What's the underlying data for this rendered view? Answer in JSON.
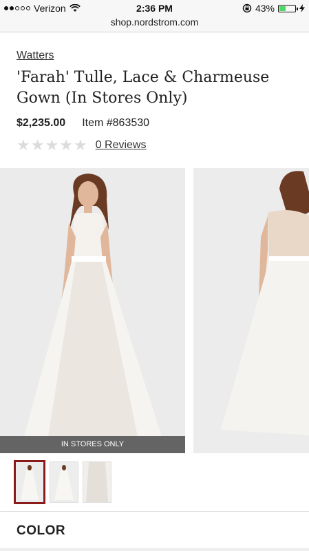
{
  "status_bar": {
    "carrier": "Verizon",
    "time": "2:36 PM",
    "battery_percent": "43%",
    "battery_level": 0.43
  },
  "browser": {
    "url": "shop.nordstrom.com"
  },
  "product": {
    "brand": "Watters",
    "title": "'Farah' Tulle, Lace & Charmeuse Gown (In Stores Only)",
    "price": "$2,235.00",
    "item_number": "Item #863530",
    "rating": 0,
    "reviews_label": "0 Reviews"
  },
  "gallery": {
    "banner": "IN STORES ONLY"
  },
  "options": {
    "color_label": "COLOR"
  },
  "colors": {
    "accent": "#8b1a1a",
    "battery": "#4cd964"
  }
}
